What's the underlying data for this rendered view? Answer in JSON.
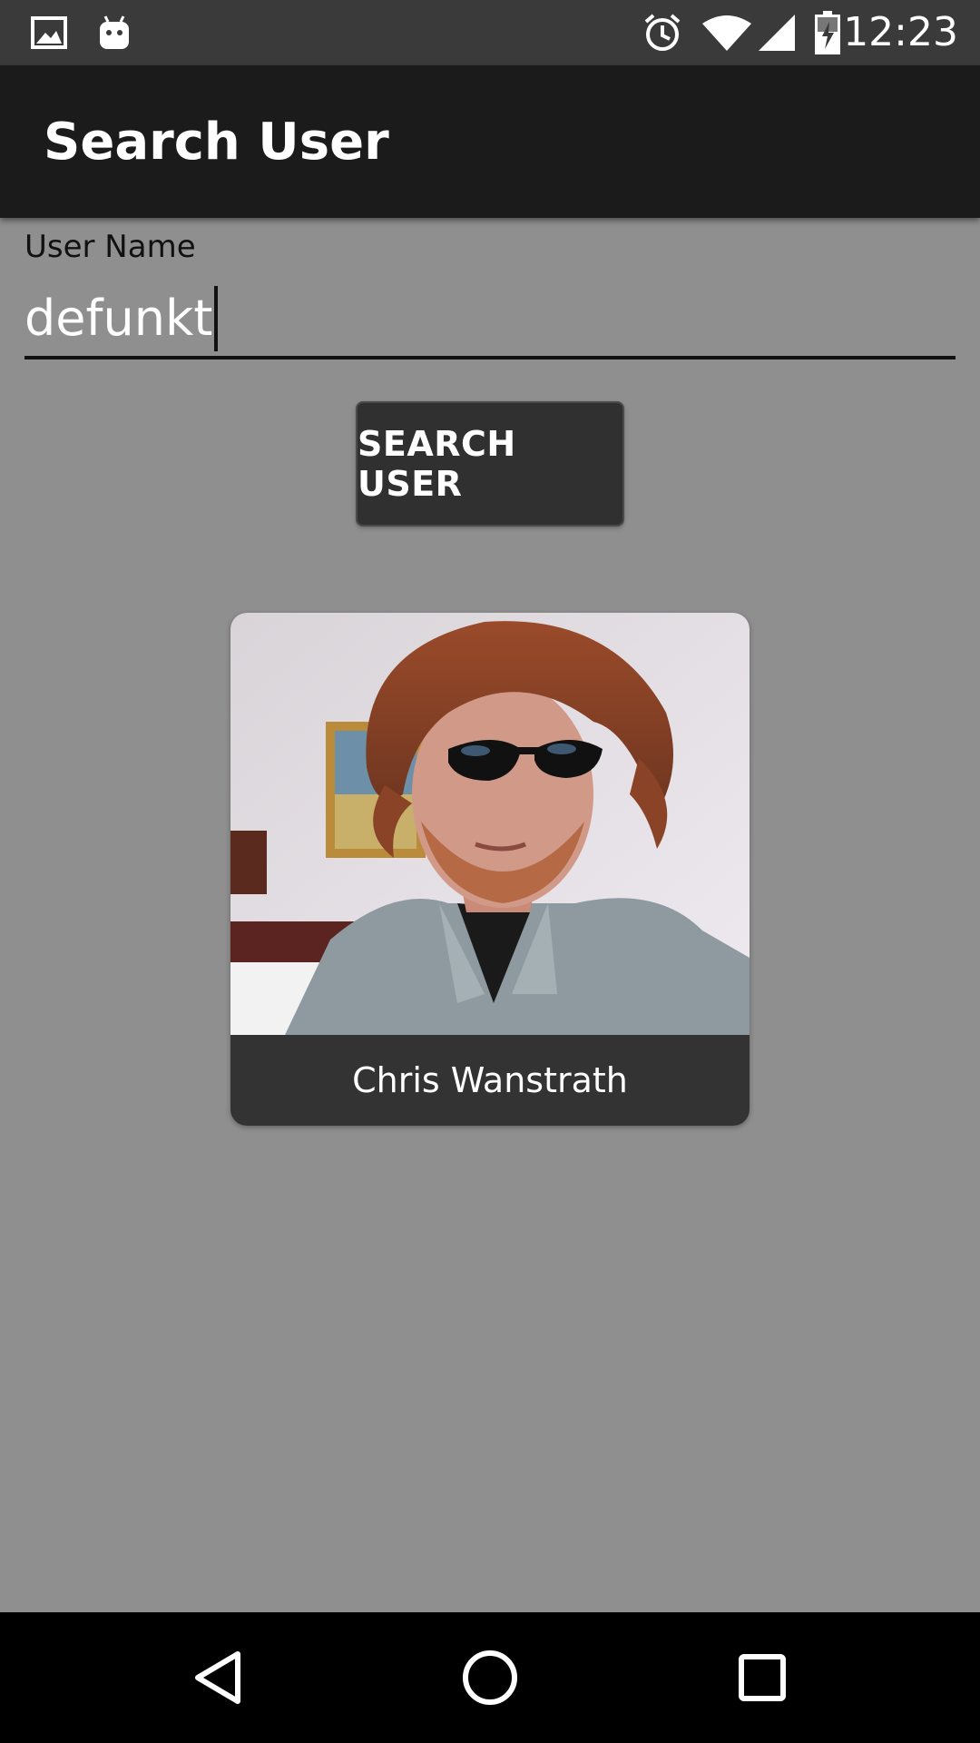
{
  "status_bar": {
    "time": "12:23",
    "left_icons": [
      "image-icon",
      "android-icon"
    ],
    "right_icons": [
      "alarm-icon",
      "wifi-icon",
      "signal-icon",
      "battery-charging-icon"
    ]
  },
  "app_bar": {
    "title": "Search User"
  },
  "form": {
    "label": "User Name",
    "value": "defunkt",
    "search_button": "SEARCH USER"
  },
  "result_card": {
    "name": "Chris Wanstrath",
    "photo": "avatar-photo"
  },
  "nav_bar": {
    "buttons": [
      "back-icon",
      "home-icon",
      "recents-icon"
    ]
  },
  "colors": {
    "background": "#8f8f8f",
    "app_bar": "#1b1b1b",
    "status_bar": "#3a3a3a",
    "button": "#303030",
    "card": "#333333"
  }
}
